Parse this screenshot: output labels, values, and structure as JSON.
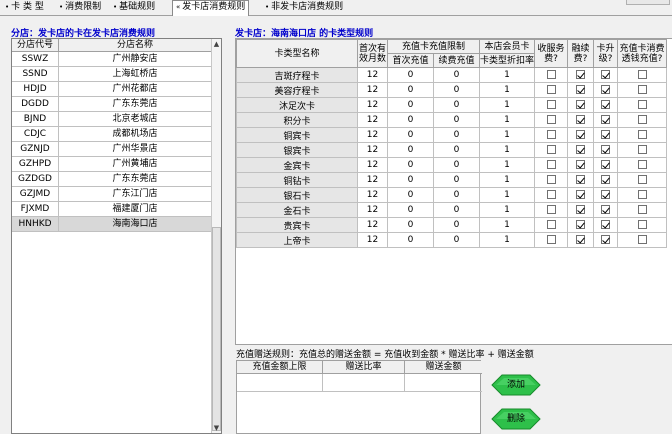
{
  "tabs": [
    {
      "label": "卡 类 型",
      "active": false
    },
    {
      "label": "消费限制",
      "active": false
    },
    {
      "label": "基础规则",
      "active": false
    },
    {
      "label": "发卡店消费规则",
      "active": true
    },
    {
      "label": "非发卡店消费规则",
      "active": false
    }
  ],
  "left": {
    "title": "分店：发卡店的卡在发卡店消费规则",
    "headers": [
      "分店代号",
      "分店名称"
    ],
    "rows": [
      {
        "code": "SSWZ",
        "name": "广州静安店"
      },
      {
        "code": "SSND",
        "name": "上海虹桥店"
      },
      {
        "code": "HDJD",
        "name": "广州花都店"
      },
      {
        "code": "DGDD",
        "name": "广东东莞店"
      },
      {
        "code": "BJND",
        "name": "北京老城店"
      },
      {
        "code": "CDJC",
        "name": "成都机场店"
      },
      {
        "code": "GZNJD",
        "name": "广州华景店"
      },
      {
        "code": "GZHPD",
        "name": "广州黄埔店"
      },
      {
        "code": "GZDGD",
        "name": "广东东莞店"
      },
      {
        "code": "GZJMD",
        "name": "广东江门店"
      },
      {
        "code": "FJXMD",
        "name": "福建厦门店"
      },
      {
        "code": "HNHKD",
        "name": "海南海口店"
      }
    ]
  },
  "right": {
    "title": "发卡店：海南海口店 的卡类型规则",
    "headers": {
      "card_type": "卡类型名称",
      "first_months": "首次有效月数",
      "recharge_limit": "充值卡充值限制",
      "first_recharge": "首次充值",
      "renew_recharge": "续费充值",
      "member_card": "本店会员卡",
      "discount": "卡类型折扣率",
      "service_fee": "收服务费?",
      "renew_fee": "融续费?",
      "upgrade": "卡升级?",
      "recharge_consume": "充值卡消费透钱充值?"
    },
    "rows": [
      {
        "name": "吉斑疗程卡",
        "months": "12",
        "first": "0",
        "renew": "0",
        "discount": "1",
        "service": false,
        "renewfee": true,
        "upgrade": true,
        "consume": false
      },
      {
        "name": "美容疗程卡",
        "months": "12",
        "first": "0",
        "renew": "0",
        "discount": "1",
        "service": false,
        "renewfee": true,
        "upgrade": true,
        "consume": false
      },
      {
        "name": "沐足次卡",
        "months": "12",
        "first": "0",
        "renew": "0",
        "discount": "1",
        "service": false,
        "renewfee": true,
        "upgrade": true,
        "consume": false
      },
      {
        "name": "积分卡",
        "months": "12",
        "first": "0",
        "renew": "0",
        "discount": "1",
        "service": false,
        "renewfee": true,
        "upgrade": true,
        "consume": false
      },
      {
        "name": "铜宾卡",
        "months": "12",
        "first": "0",
        "renew": "0",
        "discount": "1",
        "service": false,
        "renewfee": true,
        "upgrade": true,
        "consume": false
      },
      {
        "name": "银宾卡",
        "months": "12",
        "first": "0",
        "renew": "0",
        "discount": "1",
        "service": false,
        "renewfee": true,
        "upgrade": true,
        "consume": false
      },
      {
        "name": "金宾卡",
        "months": "12",
        "first": "0",
        "renew": "0",
        "discount": "1",
        "service": false,
        "renewfee": true,
        "upgrade": true,
        "consume": false
      },
      {
        "name": "铜钻卡",
        "months": "12",
        "first": "0",
        "renew": "0",
        "discount": "1",
        "service": false,
        "renewfee": true,
        "upgrade": true,
        "consume": false
      },
      {
        "name": "银石卡",
        "months": "12",
        "first": "0",
        "renew": "0",
        "discount": "1",
        "service": false,
        "renewfee": true,
        "upgrade": true,
        "consume": false
      },
      {
        "name": "金石卡",
        "months": "12",
        "first": "0",
        "renew": "0",
        "discount": "1",
        "service": false,
        "renewfee": true,
        "upgrade": true,
        "consume": false
      },
      {
        "name": "贵宾卡",
        "months": "12",
        "first": "0",
        "renew": "0",
        "discount": "1",
        "service": false,
        "renewfee": true,
        "upgrade": true,
        "consume": false
      },
      {
        "name": "上帝卡",
        "months": "12",
        "first": "0",
        "renew": "0",
        "discount": "1",
        "service": false,
        "renewfee": true,
        "upgrade": true,
        "consume": false
      }
    ]
  },
  "bonus": {
    "rule_text": "充值赠送规则：充值总的赠送金额 = 充值收到金额 * 赠送比率 + 赠送金额",
    "headers": [
      "充值金额上限",
      "赠送比率",
      "赠送金额"
    ],
    "add_label": "添加",
    "delete_label": "删除"
  },
  "colors": {
    "title_blue": "#0000cc",
    "button_green": "#2ec04a"
  }
}
